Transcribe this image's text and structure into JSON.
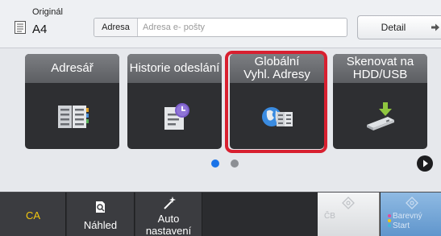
{
  "header": {
    "original_label": "Originál",
    "original_value": "A4",
    "address_label": "Adresa",
    "address_placeholder": "Adresa e- pošty",
    "detail_label": "Detail"
  },
  "tiles": [
    {
      "line1": "Adresář",
      "line2": "",
      "icon": "address-book-icon"
    },
    {
      "line1": "Historie odeslání",
      "line2": "",
      "icon": "send-history-icon"
    },
    {
      "line1": "Globální",
      "line2": "Vyhl. Adresy",
      "icon": "global-address-search-icon"
    },
    {
      "line1": "Skenovat na",
      "line2": "HDD/USB",
      "icon": "scan-to-usb-icon"
    }
  ],
  "pager": {
    "active_index": 0,
    "total": 2
  },
  "bottom": {
    "ca_label": "CA",
    "preview_label": "Náhled",
    "auto_line1": "Auto",
    "auto_line2": "nastavení",
    "mono_label": "ČB",
    "color_line1": "Barevný",
    "color_line2": "Start"
  },
  "colors": {
    "accent_blue": "#1a73e8",
    "selection_red": "#d82030",
    "ca_yellow": "#f2c70f",
    "color_start_blue": "#6fa2d3"
  }
}
